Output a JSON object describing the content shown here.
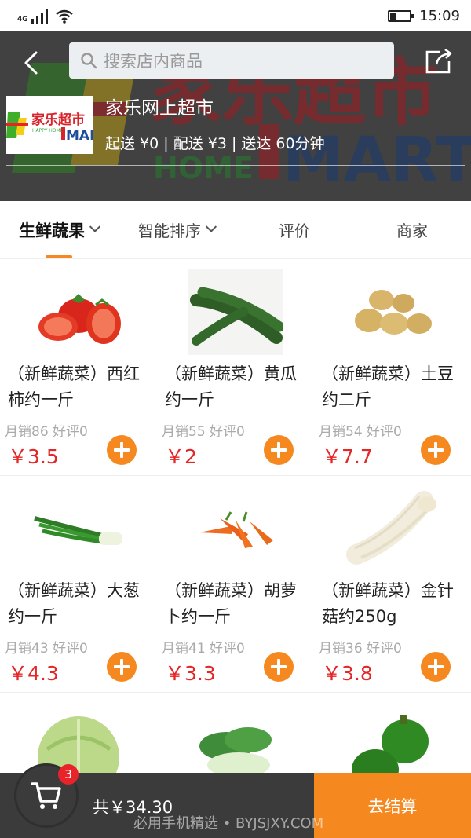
{
  "status_bar": {
    "network": "4G",
    "time": "15:09"
  },
  "header": {
    "search_placeholder": "搜索店内商品",
    "store_name": "家乐网上超市",
    "store_info": "起送 ¥0 | 配送 ¥3 | 送达 60分钟",
    "logo_text_cn": "家乐超市",
    "logo_text_en": "MART",
    "logo_text_sub": "HAPPY HOME",
    "banner_text_cn": "家乐超市",
    "banner_text_en": "MART",
    "banner_text_home": "HOME"
  },
  "tabs": [
    {
      "label": "生鲜蔬果"
    },
    {
      "label": "智能排序"
    },
    {
      "label": "评价"
    },
    {
      "label": "商家"
    }
  ],
  "products": [
    {
      "name": "（新鲜蔬菜）西红柿约一斤",
      "sales": "月销86 好评0",
      "price": "￥3.5",
      "icon": "tomato"
    },
    {
      "name": "（新鲜蔬菜）黄瓜约一斤",
      "sales": "月销55 好评0",
      "price": "￥2",
      "icon": "cucumber"
    },
    {
      "name": "（新鲜蔬菜）土豆约二斤",
      "sales": "月销54 好评0",
      "price": "￥7.7",
      "icon": "potato"
    },
    {
      "name": "（新鲜蔬菜）大葱约一斤",
      "sales": "月销43 好评0",
      "price": "￥4.3",
      "icon": "scallion"
    },
    {
      "name": "（新鲜蔬菜）胡萝卜约一斤",
      "sales": "月销41 好评0",
      "price": "￥3.3",
      "icon": "carrot"
    },
    {
      "name": "（新鲜蔬菜）金针菇约250g",
      "sales": "月销36 好评0",
      "price": "￥3.8",
      "icon": "enoki"
    }
  ],
  "partial_row_icons": [
    "cabbage",
    "bok-choy",
    "green-pepper"
  ],
  "cart": {
    "badge": "3",
    "total": "共￥34.30",
    "checkout": "去结算"
  },
  "watermark": "必用手机精选 • BYJSJXY.COM",
  "colors": {
    "accent": "#f5891f",
    "price": "#e42626",
    "badge": "#e8232a",
    "bar": "#3b3b3b"
  }
}
